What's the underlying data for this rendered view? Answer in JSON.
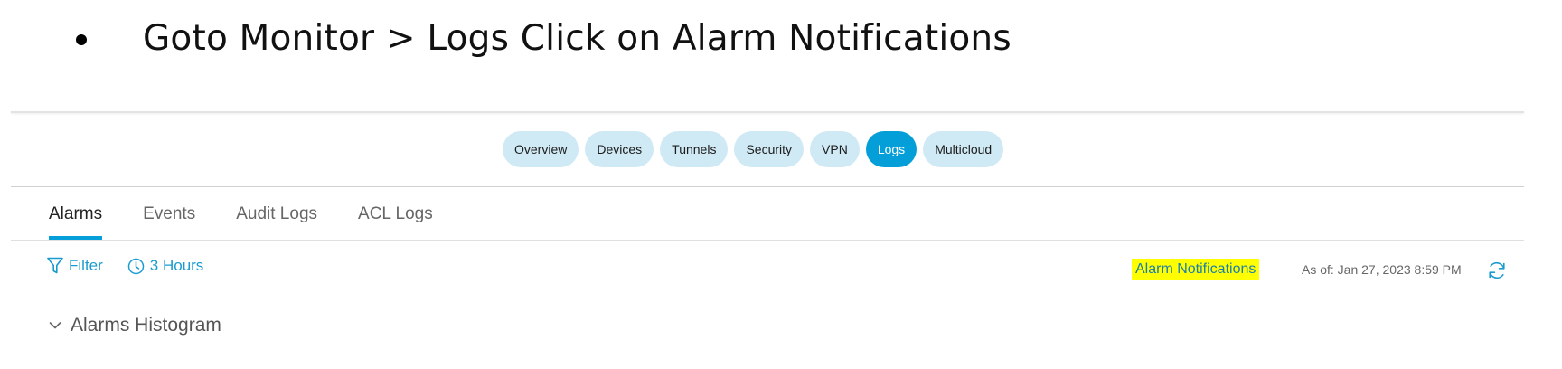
{
  "instruction": {
    "text": "Goto Monitor > Logs Click on Alarm Notifications"
  },
  "nav": {
    "pills": [
      {
        "label": "Overview",
        "active": false
      },
      {
        "label": "Devices",
        "active": false
      },
      {
        "label": "Tunnels",
        "active": false
      },
      {
        "label": "Security",
        "active": false
      },
      {
        "label": "VPN",
        "active": false
      },
      {
        "label": "Logs",
        "active": true
      },
      {
        "label": "Multicloud",
        "active": false
      }
    ]
  },
  "sub_tabs": [
    {
      "label": "Alarms",
      "active": true
    },
    {
      "label": "Events",
      "active": false
    },
    {
      "label": "Audit Logs",
      "active": false
    },
    {
      "label": "ACL Logs",
      "active": false
    }
  ],
  "toolbar": {
    "filter_label": "Filter",
    "filter_icon": "filter-icon",
    "time_label": "3 Hours",
    "time_icon": "clock-icon",
    "alarm_notifications_label": "Alarm Notifications",
    "as_of_label": "As of: Jan 27, 2023 8:59 PM",
    "refresh_icon": "refresh-icon"
  },
  "histogram": {
    "label": "Alarms Histogram",
    "icon": "chevron-down-icon"
  },
  "colors": {
    "accent": "#049fd9",
    "pill_bg": "#cfeaf4",
    "highlight": "#ffff00",
    "link": "#1a9bd0"
  }
}
